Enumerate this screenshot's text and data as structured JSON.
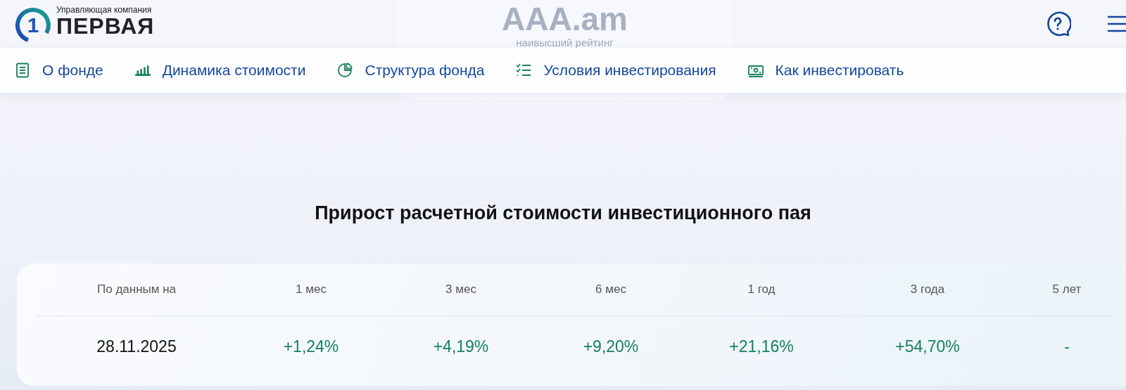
{
  "header": {
    "logo": {
      "mark": "1",
      "caption": "Управляющая компания",
      "name": "ПЕРВАЯ"
    }
  },
  "rating_card": {
    "rating": "AAA.am",
    "caption": "наивысший рейтинг"
  },
  "nav": [
    {
      "kind": "document",
      "label": "О фонде"
    },
    {
      "kind": "bars",
      "label": "Динамика стоимости"
    },
    {
      "kind": "pie",
      "label": "Структура фонда"
    },
    {
      "kind": "checklist",
      "label": "Условия инвестирования"
    },
    {
      "kind": "money",
      "label": "Как инвестировать"
    }
  ],
  "section": {
    "title": "Прирост расчетной стоимости инвестиционного пая"
  },
  "table": {
    "columns": [
      "По данным на",
      "1 мес",
      "3 мес",
      "6 мес",
      "1 год",
      "3 года",
      "5 лет"
    ],
    "rows": [
      {
        "date": "28.11.2025",
        "values": [
          "+1,24%",
          "+4,19%",
          "+9,20%",
          "+21,16%",
          "+54,70%",
          "-"
        ]
      }
    ]
  }
}
